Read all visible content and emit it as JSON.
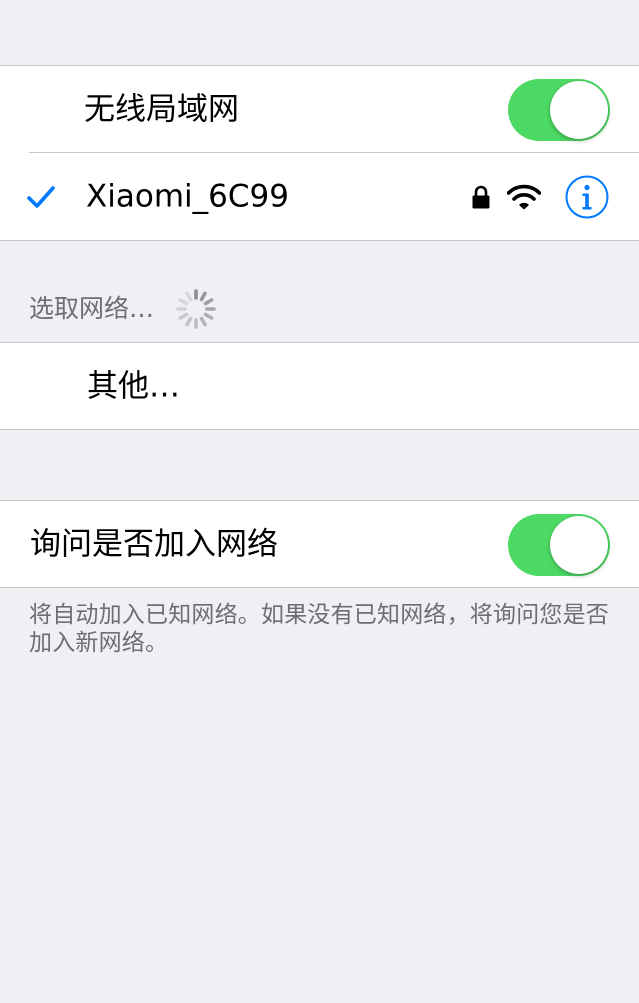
{
  "wifi_section": {
    "toggle_label": "无线局域网",
    "toggle_on": true,
    "connected_network": {
      "name": "Xiaomi_6C99",
      "secured": true,
      "selected": true
    }
  },
  "choose_network": {
    "header": "选取网络…",
    "other_label": "其他…"
  },
  "ask_to_join": {
    "label": "询问是否加入网络",
    "toggle_on": true,
    "footer": "将自动加入已知网络。如果没有已知网络，将询问您是否加入新网络。"
  },
  "colors": {
    "background": "#efeff4",
    "toggle_on": "#4cd964",
    "accent": "#007aff",
    "secondary_text": "#6d6d72",
    "separator": "#c8c7cc"
  },
  "icons": {
    "checkmark": "checkmark-icon",
    "lock": "lock-icon",
    "wifi": "wifi-icon",
    "info": "info-icon",
    "spinner": "spinner-icon"
  }
}
